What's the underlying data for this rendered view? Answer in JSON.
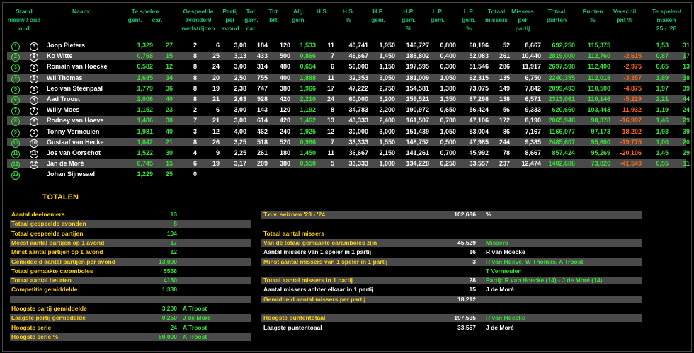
{
  "headers": [
    {
      "key": "stand",
      "text": "Stand\nnieuw / oud\noud"
    },
    {
      "key": "naam",
      "text": "Naam:"
    },
    {
      "key": "tespelen",
      "text": "Te spelen\ngem.      car."
    },
    {
      "key": "gesp",
      "text": "Gespeelde\navonden/\nwedstrijden"
    },
    {
      "key": "partij",
      "text": "Partij\nper\navond"
    },
    {
      "key": "totgem",
      "text": "Tot.\ngem.\ncar."
    },
    {
      "key": "totbrt",
      "text": "Tot.\nbrt."
    },
    {
      "key": "alg",
      "text": "Alg.\ngem."
    },
    {
      "key": "hs",
      "text": "H.S."
    },
    {
      "key": "hspct",
      "text": "H.S.\n%"
    },
    {
      "key": "hp",
      "text": "H.P.\ngem."
    },
    {
      "key": "hppct",
      "text": "H.P.\ngem.\n%"
    },
    {
      "key": "lp",
      "text": "L.P.\ngem."
    },
    {
      "key": "lppct",
      "text": "L.P.\ngem.\n%"
    },
    {
      "key": "totmis",
      "text": "Totaal\nmissers"
    },
    {
      "key": "mispp",
      "text": "Missers\nper\npartij"
    },
    {
      "key": "totpunt",
      "text": "Totaal\npunten"
    },
    {
      "key": "puntpct",
      "text": "Punten\n%"
    },
    {
      "key": "verschil",
      "text": "Verschil\npnt %"
    },
    {
      "key": "tespelenm",
      "text": "Te spelen/\nmaken\n25 - '26"
    }
  ],
  "rows": [
    {
      "n": "1",
      "o": "5",
      "name": "Joop Pieters",
      "gem": "1,329",
      "car": "27",
      "av": "2",
      "wd": "6",
      "ppa": "3,00",
      "totcar": "184",
      "brt": "120",
      "alg": "1,533",
      "hs": "11",
      "hspct": "40,741",
      "hp": "1,950",
      "hppct": "146,727",
      "lp": "0,800",
      "lppct": "60,196",
      "mis": "52",
      "mispp": "8,667",
      "pts": "692,250",
      "ptspct": "115,375",
      "ver": "",
      "ver_neg": false,
      "tsg": "1,53",
      "tsc": "31"
    },
    {
      "n": "2",
      "o": "8",
      "name": "Ko Witte",
      "gem": "0,768",
      "car": "15",
      "av": "8",
      "wd": "25",
      "ppa": "3,13",
      "totcar": "433",
      "brt": "500",
      "alg": "0,866",
      "hs": "7",
      "hspct": "46,667",
      "hp": "1,450",
      "hppct": "188,802",
      "lp": "0,400",
      "lppct": "52,083",
      "mis": "261",
      "mispp": "10,440",
      "pts": "2819,000",
      "ptspct": "112,760",
      "ver": "-2,615",
      "ver_neg": true,
      "tsg": "0,87",
      "tsc": "17"
    },
    {
      "n": "3",
      "o": "2",
      "name": "Romain van Hoecke",
      "gem": "0,582",
      "car": "12",
      "av": "8",
      "wd": "24",
      "ppa": "3,00",
      "totcar": "314",
      "brt": "480",
      "alg": "0,654",
      "hs": "6",
      "hspct": "50,000",
      "hp": "1,150",
      "hppct": "197,595",
      "lp": "0,300",
      "lppct": "51,546",
      "mis": "286",
      "mispp": "11,917",
      "pts": "2697,598",
      "ptspct": "112,400",
      "ver": "-2,975",
      "ver_neg": true,
      "tsg": "0,65",
      "tsc": "13"
    },
    {
      "n": "4",
      "o": "1",
      "name": "Wil Thomas",
      "gem": "1,685",
      "car": "34",
      "av": "8",
      "wd": "20",
      "ppa": "2,50",
      "totcar": "755",
      "brt": "400",
      "alg": "1,888",
      "hs": "11",
      "hspct": "32,353",
      "hp": "3,050",
      "hppct": "181,009",
      "lp": "1,050",
      "lppct": "62,315",
      "mis": "135",
      "mispp": "6,750",
      "pts": "2240,355",
      "ptspct": "112,018",
      "ver": "-3,357",
      "ver_neg": true,
      "tsg": "1,89",
      "tsc": "38"
    },
    {
      "n": "5",
      "o": "6",
      "name": "Leo van Steenpaal",
      "gem": "1,779",
      "car": "36",
      "av": "8",
      "wd": "19",
      "ppa": "2,38",
      "totcar": "747",
      "brt": "380",
      "alg": "1,966",
      "hs": "17",
      "hspct": "47,222",
      "hp": "2,750",
      "hppct": "154,581",
      "lp": "1,300",
      "lppct": "73,075",
      "mis": "149",
      "mispp": "7,842",
      "pts": "2099,493",
      "ptspct": "110,500",
      "ver": "-4,875",
      "ver_neg": true,
      "tsg": "1,97",
      "tsc": "39"
    },
    {
      "n": "6",
      "o": "4",
      "name": "Aad Troost",
      "gem": "2,006",
      "car": "40",
      "av": "8",
      "wd": "21",
      "ppa": "2,63",
      "totcar": "928",
      "brt": "420",
      "alg": "2,210",
      "hs": "24",
      "hspct": "60,000",
      "hp": "3,200",
      "hppct": "159,521",
      "lp": "1,350",
      "lppct": "67,298",
      "mis": "138",
      "mispp": "6,571",
      "pts": "2313,061",
      "ptspct": "110,146",
      "ver": "-5,229",
      "ver_neg": true,
      "tsg": "2,21",
      "tsc": "44"
    },
    {
      "n": "7",
      "o": "7",
      "name": "Willy Moes",
      "gem": "1,152",
      "car": "23",
      "av": "2",
      "wd": "6",
      "ppa": "3,00",
      "totcar": "143",
      "brt": "120",
      "alg": "1,192",
      "hs": "8",
      "hspct": "34,783",
      "hp": "2,200",
      "hppct": "190,972",
      "lp": "0,650",
      "lppct": "56,424",
      "mis": "56",
      "mispp": "9,333",
      "pts": "620,660",
      "ptspct": "103,443",
      "ver": "-11,932",
      "ver_neg": true,
      "tsg": "1,19",
      "tsc": "24"
    },
    {
      "n": "8",
      "o": "9",
      "name": "Rodney van Hoeve",
      "gem": "1,486",
      "car": "30",
      "av": "7",
      "wd": "21",
      "ppa": "3,00",
      "totcar": "614",
      "brt": "420",
      "alg": "1,462",
      "hs": "13",
      "hspct": "43,333",
      "hp": "2,400",
      "hppct": "161,507",
      "lp": "0,700",
      "lppct": "47,106",
      "mis": "172",
      "mispp": "8,190",
      "pts": "2065,948",
      "ptspct": "98,378",
      "ver": "-16,997",
      "ver_neg": true,
      "tsg": "1,46",
      "tsc": "29"
    },
    {
      "n": "9",
      "o": "3",
      "name": "Tonny Vermeulen",
      "gem": "1,981",
      "car": "40",
      "av": "3",
      "wd": "12",
      "ppa": "4,00",
      "totcar": "462",
      "brt": "240",
      "alg": "1,925",
      "hs": "12",
      "hspct": "30,000",
      "hp": "3,000",
      "hppct": "151,439",
      "lp": "1,050",
      "lppct": "53,004",
      "mis": "86",
      "mispp": "7,167",
      "pts": "1166,077",
      "ptspct": "97,173",
      "ver": "-18,202",
      "ver_neg": true,
      "tsg": "1,93",
      "tsc": "39"
    },
    {
      "n": "10",
      "o": "10",
      "name": "Gustaaf van Hecke",
      "gem": "1,042",
      "car": "21",
      "av": "8",
      "wd": "26",
      "ppa": "3,25",
      "totcar": "518",
      "brt": "520",
      "alg": "0,996",
      "hs": "7",
      "hspct": "33,333",
      "hp": "1,550",
      "hppct": "148,752",
      "lp": "0,500",
      "lppct": "47,985",
      "mis": "244",
      "mispp": "9,385",
      "pts": "2485,607",
      "ptspct": "95,600",
      "ver": "-19,775",
      "ver_neg": true,
      "tsg": "1,00",
      "tsc": "20"
    },
    {
      "n": "11",
      "o": "11",
      "name": "Jos van Oorschot",
      "gem": "1,522",
      "car": "30",
      "av": "4",
      "wd": "9",
      "ppa": "2,25",
      "totcar": "261",
      "brt": "180",
      "alg": "1,450",
      "hs": "11",
      "hspct": "36,667",
      "hp": "2,150",
      "hppct": "141,261",
      "lp": "0,700",
      "lppct": "45,992",
      "mis": "78",
      "mispp": "8,667",
      "pts": "857,424",
      "ptspct": "95,269",
      "ver": "-20,106",
      "ver_neg": true,
      "tsg": "1,45",
      "tsc": "29"
    },
    {
      "n": "12",
      "o": "12",
      "name": "Jan de Moré",
      "gem": "0,745",
      "car": "15",
      "av": "6",
      "wd": "19",
      "ppa": "3,17",
      "totcar": "209",
      "brt": "380",
      "alg": "0,550",
      "hs": "5",
      "hspct": "33,333",
      "hp": "1,000",
      "hppct": "134,228",
      "lp": "0,250",
      "lppct": "33,557",
      "mis": "237",
      "mispp": "12,474",
      "pts": "1402,686",
      "ptspct": "73,826",
      "ver": "-41,549",
      "ver_neg": true,
      "tsg": "0,55",
      "tsc": "11"
    },
    {
      "n": "13",
      "o": "",
      "name": "Johan Sijnesael",
      "gem": "1,229",
      "car": "25",
      "av": "0",
      "wd": "",
      "ppa": "",
      "totcar": "",
      "brt": "",
      "alg": "",
      "hs": "",
      "hspct": "",
      "hp": "",
      "hppct": "",
      "lp": "",
      "lppct": "",
      "mis": "",
      "mispp": "",
      "pts": "",
      "ptspct": "",
      "ver": "",
      "ver_neg": false,
      "tsg": "",
      "tsc": ""
    }
  ],
  "totalen_title": "TOTALEN",
  "left_totals": [
    {
      "label": "Aantal deelnemers",
      "value": "13",
      "extra": "",
      "alt": false
    },
    {
      "label": "Totaal gespeelde avonden",
      "value": "8",
      "extra": "",
      "alt": true
    },
    {
      "label": "Totaal gespeelde partijen",
      "value": "104",
      "extra": "",
      "alt": false
    },
    {
      "label": "Meest aantal partijen op 1 avond",
      "value": "17",
      "extra": "",
      "alt": true
    },
    {
      "label": "Minst aantal partijen op 1 avond",
      "value": "12",
      "extra": "",
      "alt": false
    },
    {
      "label": "Gemiddeld aantal partijen per avond",
      "value": "13,000",
      "extra": "",
      "alt": true
    },
    {
      "label": "Totaal gemaakte caramboles",
      "value": "5568",
      "extra": "",
      "alt": false
    },
    {
      "label": "Totaal aantal beurten",
      "value": "4160",
      "extra": "",
      "alt": true
    },
    {
      "label": "Competitie gemiddelde",
      "value": "1,338",
      "extra": "",
      "alt": false
    },
    {
      "label": "",
      "value": "",
      "extra": "",
      "alt": true
    },
    {
      "label": "Hoogste partij gemiddelde",
      "value": "3,200",
      "extra": "A Troost",
      "alt": false
    },
    {
      "label": "Laagste partij gemiddelde",
      "value": "0,250",
      "extra": "J de Moré",
      "alt": true
    },
    {
      "label": "Hoogste serie",
      "value": "24",
      "extra": "A Troost",
      "alt": false
    },
    {
      "label": "Hoogste serie %",
      "value": "60,000",
      "extra": "A Troost",
      "alt": true
    }
  ],
  "right_totals": [
    {
      "label": "T.o.v. seizoen '23 - '24",
      "value": "102,686",
      "extra": "%",
      "alt": true
    },
    {
      "label": "",
      "value": "",
      "extra": "",
      "alt": false
    },
    {
      "label": "Totaal aantal missers",
      "value": "",
      "extra": "",
      "alt": false
    },
    {
      "label": "Van de totaal gemaakte caramboles zijn",
      "value": "45,529",
      "extra": "Missers",
      "alt": true
    },
    {
      "label": "Aantal missers van 1 speler in 1 partij",
      "value": "16",
      "extra": "R van Hoecke",
      "alt": false
    },
    {
      "label": "Minst aantal missers van 1 speler in 1 partij",
      "value": "3",
      "extra": "R van Hoeve, W Thomas, A Troost,",
      "alt": true
    },
    {
      "label": "",
      "value": "",
      "extra": "T Vermeulen",
      "alt": false
    },
    {
      "label": "Totaal aantal missers in 1 partij",
      "value": "28",
      "extra": "Partij:  R van Hoecke (14) - J de Moré (14)",
      "alt": true
    },
    {
      "label": "Aantal missers achter elkaar in 1 partij",
      "value": "15",
      "extra": "J de Moré",
      "alt": false
    },
    {
      "label": "Gemiddeld aantal missers per partij",
      "value": "18,212",
      "extra": "",
      "alt": true
    },
    {
      "label": "",
      "value": "",
      "extra": "",
      "alt": false
    },
    {
      "label": "Hoogste puntentotaal",
      "value": "197,595",
      "extra": "R van Hoecke",
      "alt": true
    },
    {
      "label": "Laagste puntentoaal",
      "value": "33,557",
      "extra": "J de Moré",
      "alt": false
    }
  ]
}
